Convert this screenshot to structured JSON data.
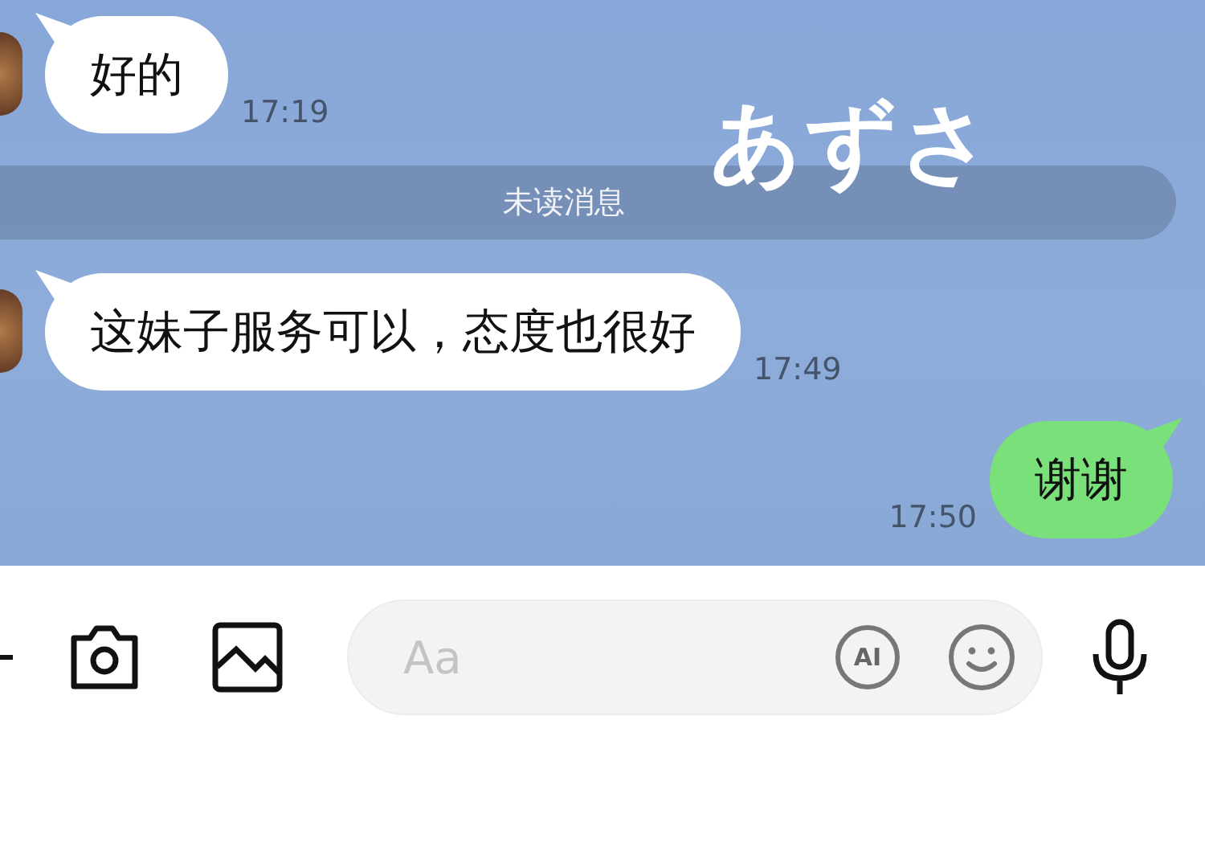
{
  "overlay_name": "あずさ",
  "messages": [
    {
      "kind": "incoming",
      "text": "好的",
      "time": "17:19"
    },
    {
      "kind": "divider",
      "text": "未读消息"
    },
    {
      "kind": "incoming",
      "text": "这妹子服务可以，态度也很好",
      "time": "17:49"
    },
    {
      "kind": "outgoing",
      "text": "谢谢",
      "time": "17:50"
    }
  ],
  "input": {
    "placeholder": "Aa",
    "ai_label": "AI"
  }
}
